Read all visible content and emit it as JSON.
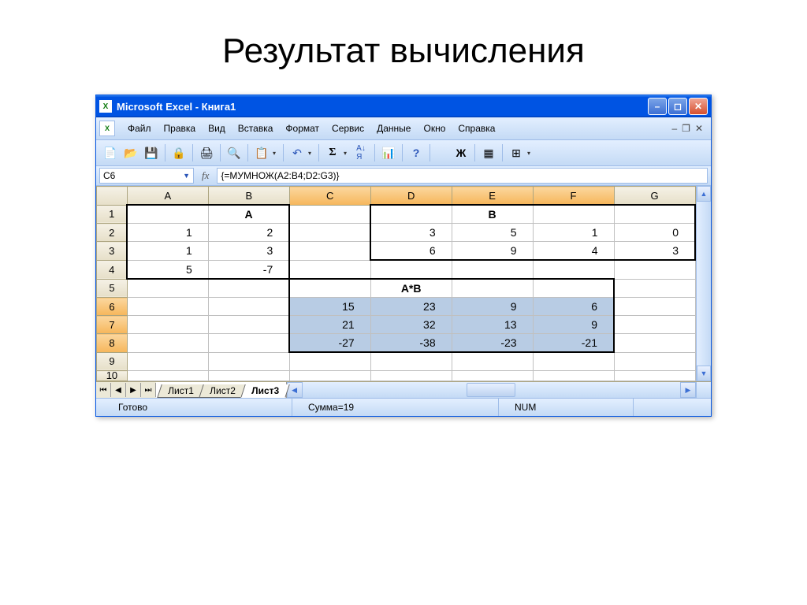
{
  "slide_title": "Результат вычисления",
  "titlebar": "Microsoft Excel - Книга1",
  "menu": [
    "Файл",
    "Правка",
    "Вид",
    "Вставка",
    "Формат",
    "Сервис",
    "Данные",
    "Окно",
    "Справка"
  ],
  "name_box": "C6",
  "formula": "{=МУМНОЖ(A2:B4;D2:G3)}",
  "columns": [
    "A",
    "B",
    "C",
    "D",
    "E",
    "F",
    "G"
  ],
  "selected_cols": [
    "C",
    "D",
    "E",
    "F"
  ],
  "rows": [
    "1",
    "2",
    "3",
    "4",
    "5",
    "6",
    "7",
    "8",
    "9",
    "10"
  ],
  "selected_rows": [
    "6",
    "7",
    "8"
  ],
  "cells": {
    "1": {
      "B": "A",
      "E": "B"
    },
    "2": {
      "A": "1",
      "B": "2",
      "D": "3",
      "E": "5",
      "F": "1",
      "G": "0"
    },
    "3": {
      "A": "1",
      "B": "3",
      "D": "6",
      "E": "9",
      "F": "4",
      "G": "3"
    },
    "4": {
      "A": "5",
      "B": "-7"
    },
    "5": {
      "D": "A*B"
    },
    "6": {
      "C": "15",
      "D": "23",
      "E": "9",
      "F": "6"
    },
    "7": {
      "C": "21",
      "D": "32",
      "E": "13",
      "F": "9"
    },
    "8": {
      "C": "-27",
      "D": "-38",
      "E": "-23",
      "F": "-21"
    }
  },
  "sheet_tabs": [
    "Лист1",
    "Лист2",
    "Лист3"
  ],
  "active_tab": "Лист3",
  "status": {
    "ready": "Готово",
    "sum": "Сумма=19",
    "num": "NUM"
  },
  "chart_data": {
    "type": "table",
    "matrices": {
      "A": [
        [
          1,
          2
        ],
        [
          1,
          3
        ],
        [
          5,
          -7
        ]
      ],
      "B": [
        [
          3,
          5,
          1,
          0
        ],
        [
          6,
          9,
          4,
          3
        ]
      ],
      "A*B": [
        [
          15,
          23,
          9,
          6
        ],
        [
          21,
          32,
          13,
          9
        ],
        [
          -27,
          -38,
          -23,
          -21
        ]
      ]
    }
  }
}
